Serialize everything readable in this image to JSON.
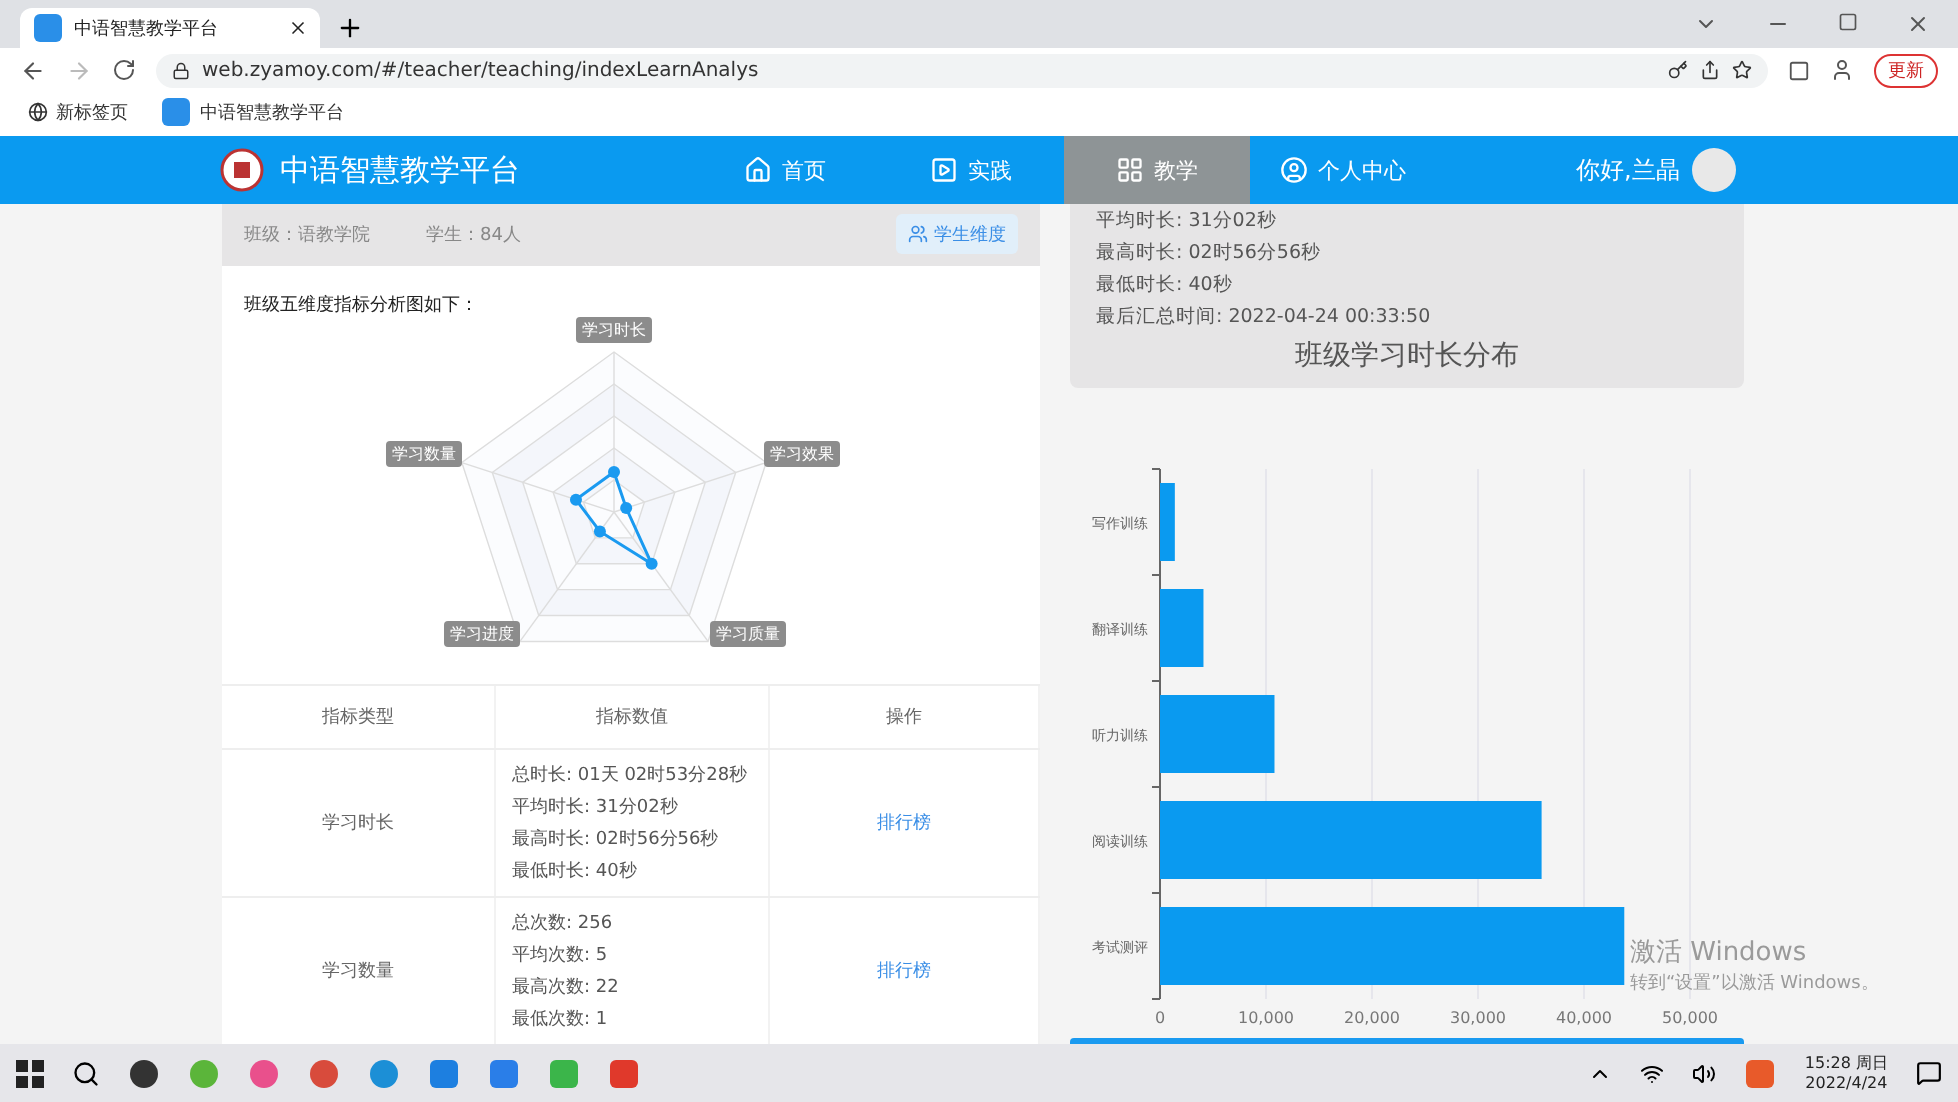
{
  "browser": {
    "tab_title": "中语智慧教学平台",
    "url": "web.zyamoy.com/#/teacher/teaching/indexLearnAnalys",
    "update_button": "更新",
    "bookmarks": [
      "新标签页",
      "中语智慧教学平台"
    ]
  },
  "nav": {
    "brand": "中语智慧教学平台",
    "items": [
      {
        "label": "首页",
        "selected": false
      },
      {
        "label": "实践",
        "selected": false
      },
      {
        "label": "教学",
        "selected": true
      },
      {
        "label": "个人中心",
        "selected": false
      }
    ],
    "greeting": "你好,兰晶"
  },
  "class_panel": {
    "class_label": "班级：语教学院",
    "students_label": "学生：84人",
    "dimension_button": "学生维度",
    "caption": "班级五维度指标分析图如下：",
    "radar_labels": [
      "学习时长",
      "学习效果",
      "学习质量",
      "学习进度",
      "学习数量"
    ],
    "table": {
      "columns": [
        "指标类型",
        "指标数值",
        "操作"
      ],
      "rows": [
        {
          "type": "学习时长",
          "values": [
            "总时长: 01天 02时53分28秒",
            "平均时长: 31分02秒",
            "最高时长: 02时56分56秒",
            "最低时长: 40秒"
          ],
          "action": "排行榜"
        },
        {
          "type": "学习数量",
          "values": [
            "总次数: 256",
            "平均次数: 5",
            "最高次数: 22",
            "最低次数: 1"
          ],
          "action": "排行榜"
        }
      ]
    }
  },
  "duration_panel": {
    "lines": [
      "平均时长: 31分02秒",
      "最高时长: 02时56分56秒",
      "最低时长: 40秒",
      "最后汇总时间: 2022-04-24 00:33:50"
    ],
    "title": "班级学习时长分布",
    "chart_data": {
      "type": "bar",
      "orientation": "horizontal",
      "grid": true,
      "categories": [
        "写作训练",
        "翻译训练",
        "听力训练",
        "阅读训练",
        "考试测评"
      ],
      "values": [
        1400,
        4100,
        10800,
        36000,
        43800
      ],
      "xlim": [
        0,
        50000
      ],
      "xticks": [
        {
          "value": 0,
          "label": "0"
        },
        {
          "value": 10000,
          "label": "10,000"
        },
        {
          "value": 20000,
          "label": "20,000"
        },
        {
          "value": 30000,
          "label": "30,000"
        },
        {
          "value": 40000,
          "label": "40,000"
        },
        {
          "value": 50000,
          "label": "50,000"
        }
      ]
    }
  },
  "activation_notice": {
    "title": "激活 Windows",
    "hint": "转到“设置”以激活 Windows。"
  },
  "taskbar": {
    "time": "15:28 周日",
    "date": "2022/4/24"
  }
}
